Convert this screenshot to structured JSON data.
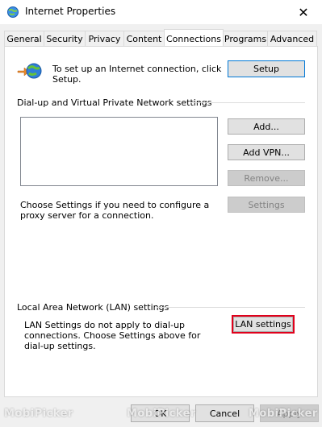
{
  "window": {
    "title": "Internet Properties",
    "close_glyph": "✕"
  },
  "tabs": [
    {
      "label": "General"
    },
    {
      "label": "Security"
    },
    {
      "label": "Privacy"
    },
    {
      "label": "Content"
    },
    {
      "label": "Connections",
      "active": true
    },
    {
      "label": "Programs"
    },
    {
      "label": "Advanced"
    }
  ],
  "setup": {
    "text": "To set up an Internet connection, click Setup.",
    "button": "Setup"
  },
  "vpn": {
    "group_label": "Dial-up and Virtual Private Network settings",
    "add_button": "Add...",
    "add_vpn_button": "Add VPN...",
    "remove_button": "Remove...",
    "settings_button": "Settings",
    "proxy_text": "Choose Settings if you need to configure a proxy server for a connection."
  },
  "lan": {
    "group_label": "Local Area Network (LAN) settings",
    "text": "LAN Settings do not apply to dial-up connections. Choose Settings above for dial-up settings.",
    "button": "LAN settings"
  },
  "footer": {
    "ok": "OK",
    "cancel": "Cancel",
    "apply": "Apply"
  },
  "watermark": {
    "text": "MobiPicker"
  },
  "colors": {
    "highlight": "#e0001b",
    "accent": "#0078d7"
  }
}
